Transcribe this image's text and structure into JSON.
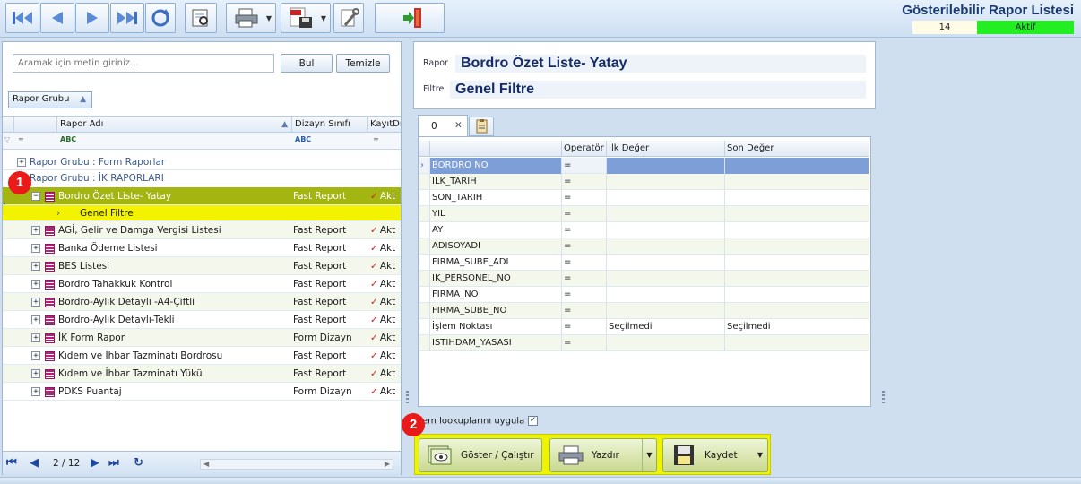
{
  "header": {
    "title": "Gösterilebilir Rapor Listesi",
    "count": "14",
    "state": "Aktif"
  },
  "search": {
    "placeholder": "Aramak için metin giriniz...",
    "find_label": "Bul",
    "clear_label": "Temizle"
  },
  "group_chip": "Rapor Grubu",
  "grid": {
    "columns": [
      "Rapor Adı",
      "Dizayn Sınıfı",
      "KayıtDı"
    ],
    "groups": [
      "Rapor Grubu : Form Raporlar",
      "Rapor Grubu : İK RAPORLARI"
    ],
    "selected": {
      "name": "Bordro Özet Liste- Yatay",
      "class": "Fast Report",
      "state": "Akt"
    },
    "sub_row": "Genel Filtre",
    "rows": [
      {
        "name": "AGİ, Gelir ve Damga Vergisi Listesi",
        "class": "Fast Report",
        "state": "Akt"
      },
      {
        "name": "Banka Ödeme Listesi",
        "class": "Fast Report",
        "state": "Akt"
      },
      {
        "name": "BES Listesi",
        "class": "Fast Report",
        "state": "Akt"
      },
      {
        "name": "Bordro Tahakkuk Kontrol",
        "class": "Fast Report",
        "state": "Akt"
      },
      {
        "name": "Bordro-Aylık Detaylı -A4-Çiftli",
        "class": "Fast Report",
        "state": "Akt"
      },
      {
        "name": "Bordro-Aylık Detaylı-Tekli",
        "class": "Fast Report",
        "state": "Akt"
      },
      {
        "name": "İK Form Rapor",
        "class": "Form Dizayn",
        "state": "Akt"
      },
      {
        "name": "Kıdem ve İhbar Tazminatı Bordrosu",
        "class": "Fast Report",
        "state": "Akt"
      },
      {
        "name": "Kıdem ve İhbar Tazminatı Yükü",
        "class": "Fast Report",
        "state": "Akt"
      },
      {
        "name": "PDKS Puantaj",
        "class": "Form Dizayn",
        "state": "Akt"
      }
    ]
  },
  "pager": {
    "text": "2 / 12"
  },
  "badges": {
    "one": "1",
    "two": "2"
  },
  "report": {
    "rapor_label": "Rapor",
    "rapor_value": "Bordro Özet Liste- Yatay",
    "filtre_label": "Filtre",
    "filtre_value": "Genel Filtre"
  },
  "tab": {
    "label": "0",
    "close": "✕"
  },
  "filter_grid": {
    "columns": [
      "Operatör",
      "İlk Değer",
      "Son Değer"
    ],
    "rows": [
      {
        "field": "BORDRO NO",
        "op": "=",
        "first": "",
        "last": ""
      },
      {
        "field": "ILK_TARIH",
        "op": "=",
        "first": "",
        "last": ""
      },
      {
        "field": "SON_TARIH",
        "op": "=",
        "first": "",
        "last": ""
      },
      {
        "field": "YIL",
        "op": "=",
        "first": "",
        "last": ""
      },
      {
        "field": "AY",
        "op": "=",
        "first": "",
        "last": ""
      },
      {
        "field": "ADISOYADI",
        "op": "=",
        "first": "",
        "last": ""
      },
      {
        "field": "FIRMA_SUBE_ADI",
        "op": "=",
        "first": "",
        "last": ""
      },
      {
        "field": "IK_PERSONEL_NO",
        "op": "=",
        "first": "",
        "last": ""
      },
      {
        "field": "FIRMA_NO",
        "op": "=",
        "first": "",
        "last": ""
      },
      {
        "field": "FIRMA_SUBE_NO",
        "op": "=",
        "first": "",
        "last": ""
      },
      {
        "field": "İşlem Noktası",
        "op": "=",
        "first": "Seçilmedi",
        "last": "Seçilmedi"
      },
      {
        "field": "ISTIHDAM_YASASI",
        "op": "=",
        "first": "",
        "last": ""
      }
    ]
  },
  "lookup": {
    "label": "em lookuplarını uygula",
    "checked": "✓"
  },
  "actions": {
    "show": "Göster / Çalıştır",
    "print": "Yazdır",
    "save": "Kaydet"
  },
  "colors": {
    "highlight": "#f0f300",
    "selected_row": "#a3b510",
    "badge": "#e81a1a",
    "active_state": "#22ee22"
  }
}
